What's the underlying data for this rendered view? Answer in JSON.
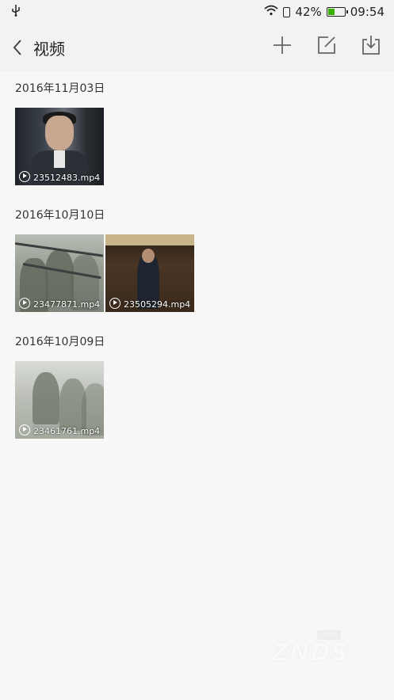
{
  "status_bar": {
    "battery_percent": "42%",
    "time": "09:54",
    "battery_level": 0.42,
    "battery_color": "#38b000"
  },
  "header": {
    "title": "视频",
    "icons": [
      "back-arrow-icon",
      "add-icon",
      "edit-icon",
      "download-icon"
    ]
  },
  "sections": [
    {
      "date": "2016年11月03日",
      "videos": [
        {
          "name": "23512483.mp4"
        }
      ]
    },
    {
      "date": "2016年10月10日",
      "videos": [
        {
          "name": "23477871.mp4"
        },
        {
          "name": "23505294.mp4"
        }
      ]
    },
    {
      "date": "2016年10月09日",
      "videos": [
        {
          "name": "23461761.mp4"
        }
      ]
    }
  ],
  "watermark": {
    "text": "ZNDS",
    "sub": ".com"
  }
}
